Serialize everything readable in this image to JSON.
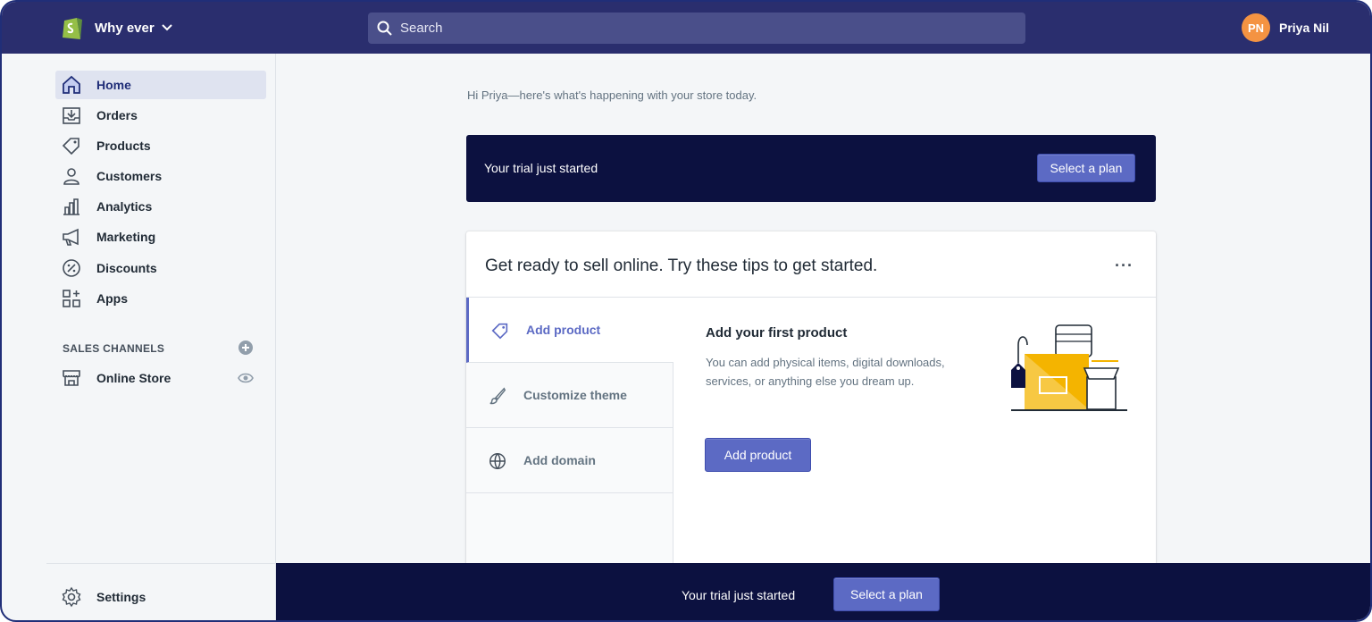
{
  "topbar": {
    "store_name": "Why ever",
    "search_placeholder": "Search",
    "user_initials": "PN",
    "user_name": "Priya Nil"
  },
  "sidebar": {
    "items": [
      {
        "label": "Home",
        "icon": "home-icon"
      },
      {
        "label": "Orders",
        "icon": "orders-icon"
      },
      {
        "label": "Products",
        "icon": "tag-icon"
      },
      {
        "label": "Customers",
        "icon": "person-icon"
      },
      {
        "label": "Analytics",
        "icon": "bar-chart-icon"
      },
      {
        "label": "Marketing",
        "icon": "megaphone-icon"
      },
      {
        "label": "Discounts",
        "icon": "discount-icon"
      },
      {
        "label": "Apps",
        "icon": "apps-icon"
      }
    ],
    "sales_channels_title": "SALES CHANNELS",
    "online_store_label": "Online Store",
    "settings_label": "Settings"
  },
  "main": {
    "greeting": "Hi Priya—here's what's happening with your store today.",
    "trial_text": "Your trial just started",
    "trial_button": "Select a plan",
    "card_title": "Get ready to sell online. Try these tips to get started.",
    "more_label": "···",
    "tabs": [
      {
        "label": "Add product",
        "icon": "tag-icon"
      },
      {
        "label": "Customize theme",
        "icon": "brush-icon"
      },
      {
        "label": "Add domain",
        "icon": "globe-icon"
      }
    ],
    "tip_title": "Add your first product",
    "tip_body": "You can add physical items, digital downloads, services, or anything else you dream up.",
    "tip_button": "Add product"
  },
  "bottom_bar": {
    "text": "Your trial just started",
    "button": "Select a plan"
  },
  "colors": {
    "topbar": "#2a2e6e",
    "banner": "#0c1140",
    "accent": "#5c6ac4",
    "avatar": "#f49342"
  }
}
